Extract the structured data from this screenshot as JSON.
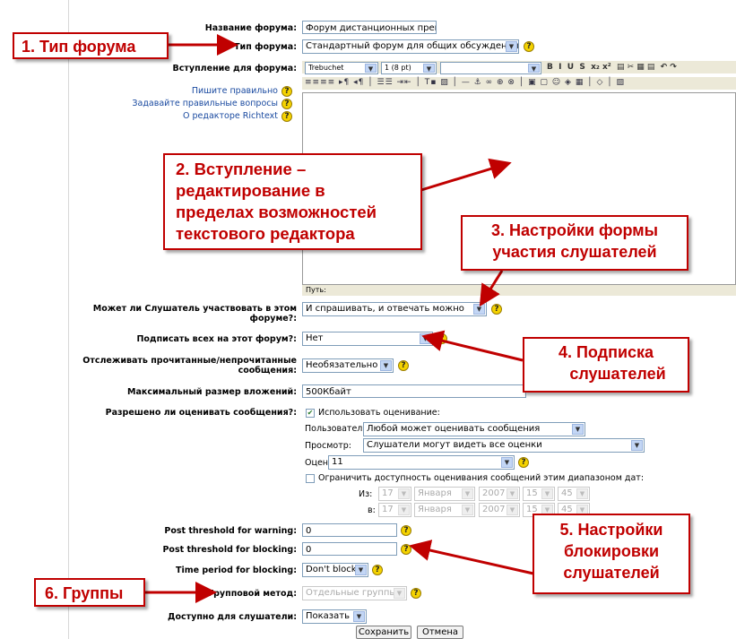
{
  "form": {
    "name_label": "Название форума:",
    "name_value": "Форум дистанционных препод",
    "type_label": "Тип форума:",
    "type_value": "Стандартный форум для общих обсуждений",
    "intro_label": "Вступление для форума:",
    "editor_font": "Trebuchet",
    "editor_size": "1 (8 pt)",
    "editor_path_label": "Путь:",
    "help_links": [
      "Пишите правильно",
      "Задавайте правильные вопросы",
      "О редакторе Richtext"
    ],
    "participate_label": "Может ли Слушатель участвовать в этом форуме?:",
    "participate_value": "И спрашивать, и отвечать можно",
    "subscribe_label": "Подписать всех на этот форум?:",
    "subscribe_value": "Нет",
    "track_label": "Отслеживать прочитанные/непрочитанные сообщения:",
    "track_value": "Необязательно",
    "max_attach_label": "Максимальный размер вложений:",
    "max_attach_value": "500Кбайт",
    "rating_label": "Разрешено ли оценивать сообщения?:",
    "use_rating_label": "Использовать оценивание:",
    "users_label": "Пользователи:",
    "users_value": "Любой может оценивать сообщения",
    "view_label": "Просмотр:",
    "view_value": "Слушатели могут видеть все оценки",
    "grade_label": "Оценка:",
    "grade_value": "11",
    "restrict_label": "Ограничить доступность оценивания сообщений этим диапазоном дат:",
    "from_label": "Из:",
    "to_label": "в:",
    "date_day": "17",
    "date_month": "Января",
    "date_year": "2007",
    "date_hour": "15",
    "date_min": "45",
    "warn_label": "Post threshold for warning:",
    "warn_value": "0",
    "block_label": "Post threshold for blocking:",
    "block_value": "0",
    "period_label": "Time period for blocking:",
    "period_value": "Don't block",
    "group_label": "Групповой метод:",
    "group_value": "Отдельные группы",
    "avail_label": "Доступно для слушатели:",
    "avail_value": "Показать",
    "save_button": "Сохранить",
    "cancel_button": "Отмена"
  },
  "callouts": {
    "c1": "1. Тип форума",
    "c2_1": "2. Вступление –",
    "c2_2": "редактирование в",
    "c2_3": "пределах возможностей",
    "c2_4": "текстового редактора",
    "c3_1": "3. Настройки формы",
    "c3_2": "участия слушателей",
    "c4_1": "4. Подписка",
    "c4_2": "слушателей",
    "c5_1": "5. Настройки",
    "c5_2": "блокировки",
    "c5_3": "слушателей",
    "c6": "6. Группы"
  },
  "colors": {
    "accent": "#c00000",
    "help": "#f5d300",
    "field_border": "#7f9db9"
  }
}
